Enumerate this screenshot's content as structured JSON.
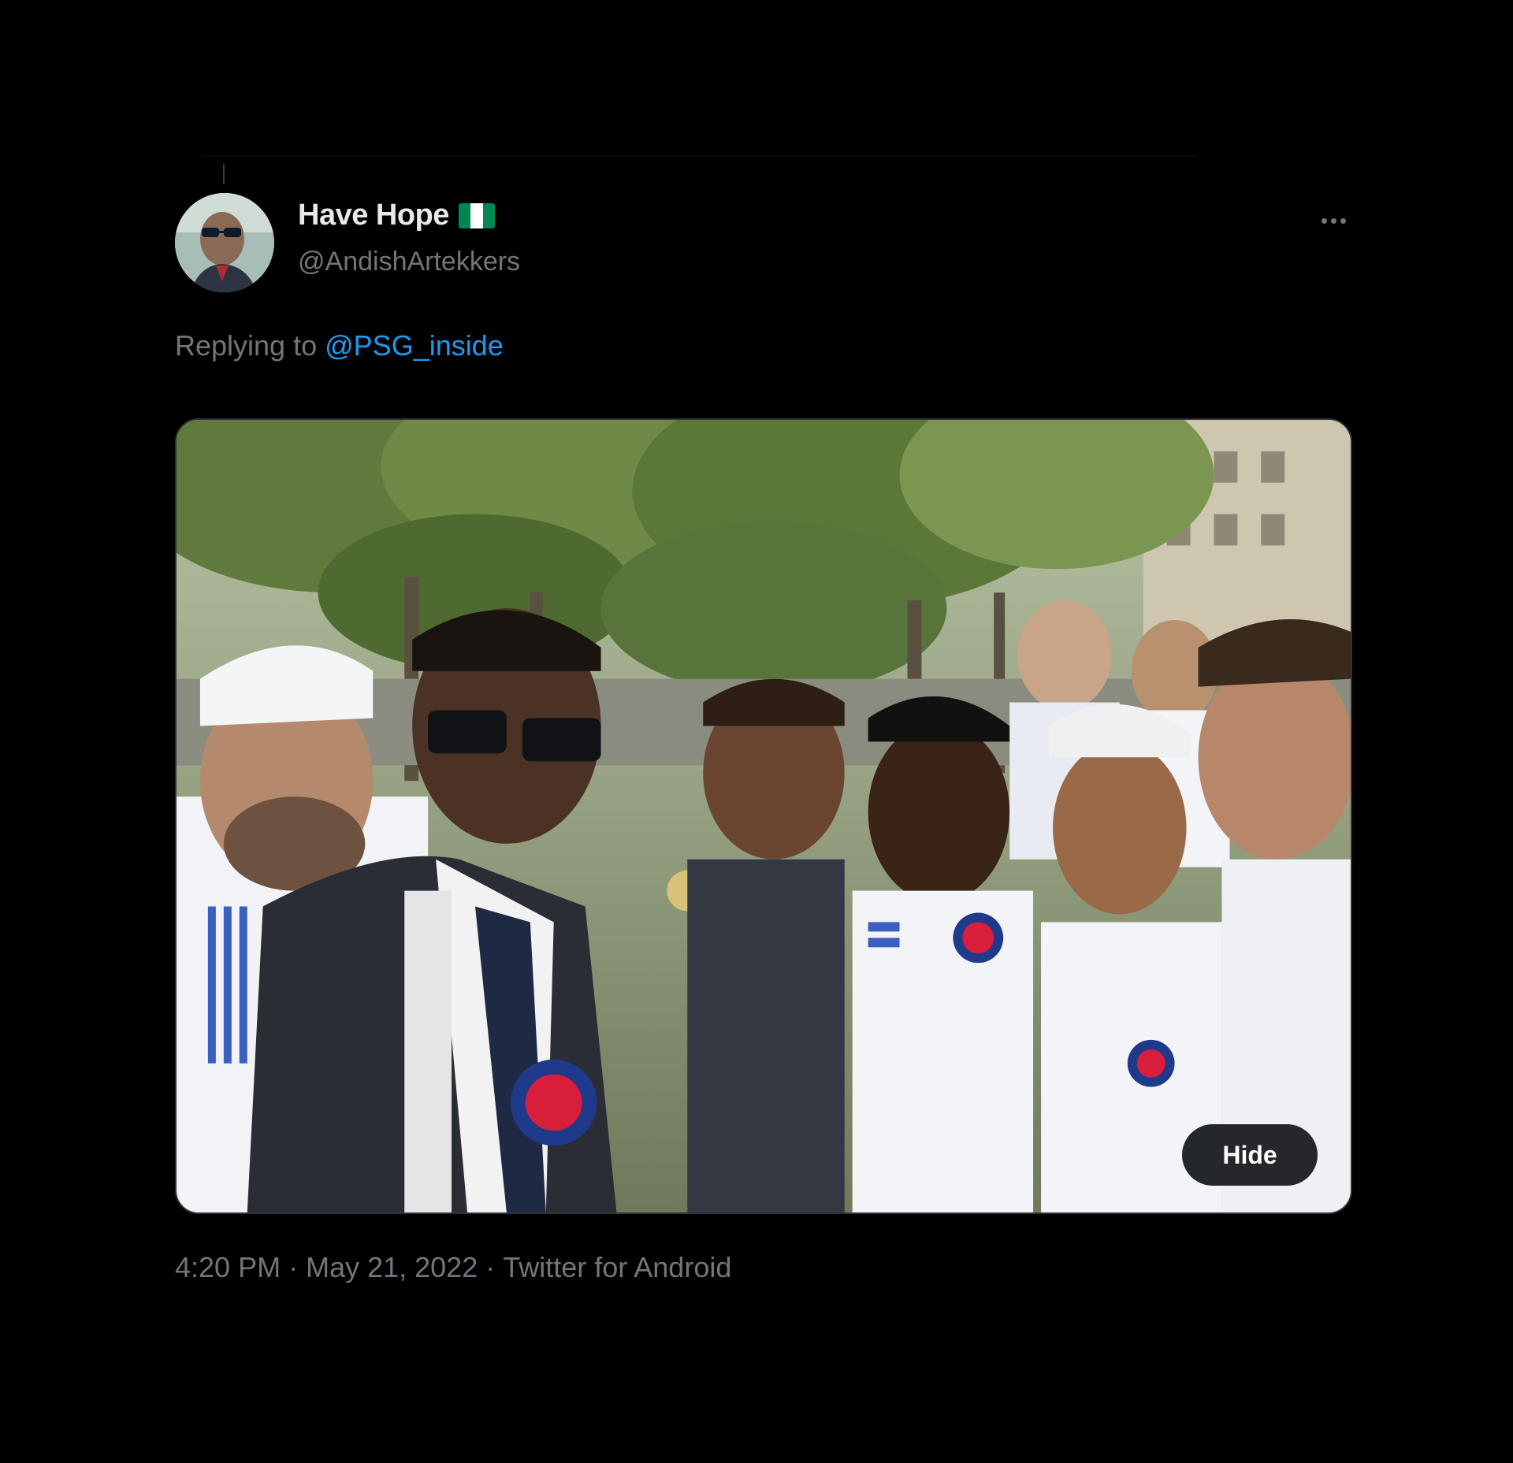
{
  "tweet": {
    "author": {
      "display_name": "Have Hope",
      "flag_icon": "nigeria-flag-icon",
      "flag_colors": [
        "#008751",
        "#ffffff",
        "#008751"
      ],
      "handle": "@AndishArtekkers"
    },
    "more_icon": "more-horizontal-icon",
    "reply": {
      "prefix": "Replying to",
      "mention": "@PSG_inside"
    },
    "media": {
      "hide_label": "Hide"
    },
    "meta": {
      "time": "4:20 PM",
      "separator_1": "·",
      "date": "May 21, 2022",
      "separator_2": "·",
      "source": "Twitter for Android"
    }
  },
  "colors": {
    "background": "#000000",
    "text_primary": "#e7e9ea",
    "text_secondary": "#71767b",
    "link": "#1d9bf0"
  }
}
